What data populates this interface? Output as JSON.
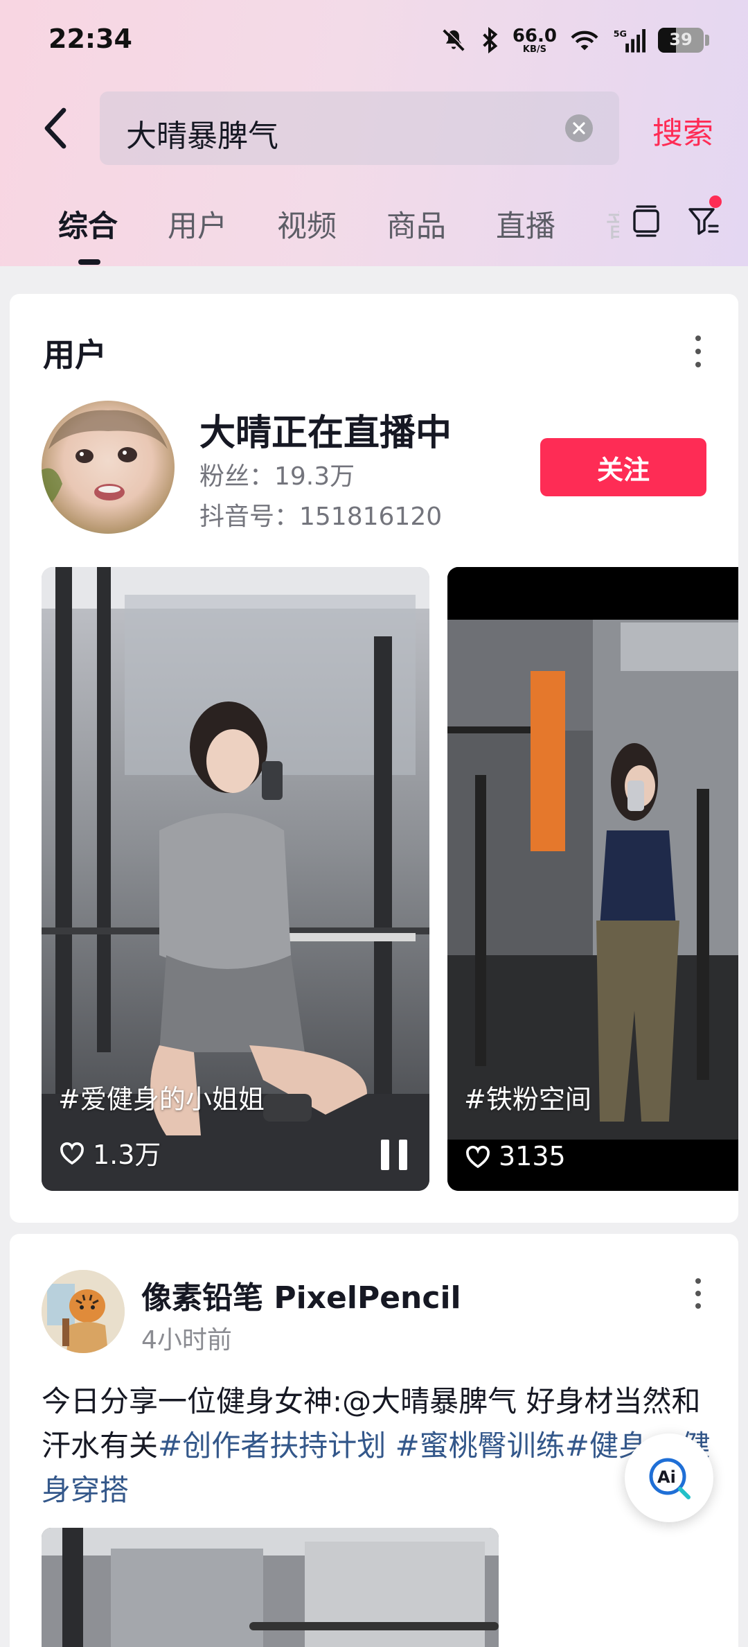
{
  "status_bar": {
    "time": "22:34",
    "net_speed": "66.0",
    "net_unit": "KB/S",
    "network": "5G",
    "battery": "39",
    "battery_level": 0.39
  },
  "search": {
    "query": "大晴暴脾气",
    "action_label": "搜索"
  },
  "tabs": {
    "items": [
      {
        "label": "综合"
      },
      {
        "label": "用户"
      },
      {
        "label": "视频"
      },
      {
        "label": "商品"
      },
      {
        "label": "直播"
      },
      {
        "label": "音"
      }
    ]
  },
  "user_section": {
    "title": "用户",
    "user": {
      "name": "大晴正在直播中",
      "fans": "粉丝：19.3万",
      "douyin_id": "抖音号：151816120",
      "follow_label": "关注"
    },
    "videos": [
      {
        "tag": "#爱健身的小姐姐",
        "likes": "1.3万"
      },
      {
        "tag": "#铁粉空间",
        "likes": "3135"
      }
    ]
  },
  "post": {
    "author": "像素铅笔 PixelPencil",
    "time": "4小时前",
    "text_plain": "今日分享一位健身女神:@大晴暴脾气 好身材当然和汗水有关",
    "hashtags": [
      "#创作者扶持计划",
      "#蜜桃臀训练",
      "#健身",
      "#健身穿搭"
    ]
  },
  "colors": {
    "accent": "#fe2c55",
    "hashtag": "#33578a"
  }
}
